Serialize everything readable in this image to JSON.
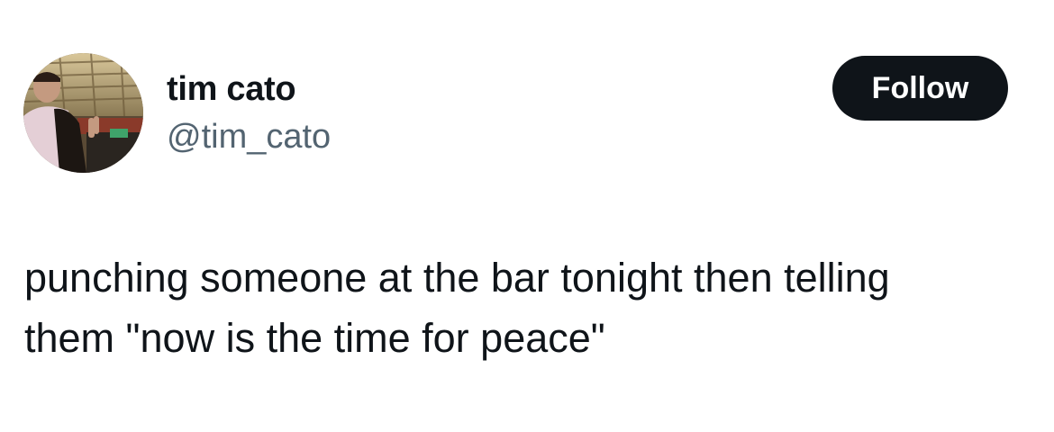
{
  "author": {
    "display_name": "tim cato",
    "handle": "@tim_cato",
    "avatar_icon": "profile-photo"
  },
  "follow_button": {
    "label": "Follow"
  },
  "tweet": {
    "lines": [
      "punching someone at the bar tonight then telling",
      "them \"now is the time for peace\""
    ]
  },
  "colors": {
    "text": "#0f1419",
    "secondary_text": "#536471",
    "button_bg": "#0f1419",
    "button_text": "#ffffff",
    "background": "#ffffff"
  }
}
